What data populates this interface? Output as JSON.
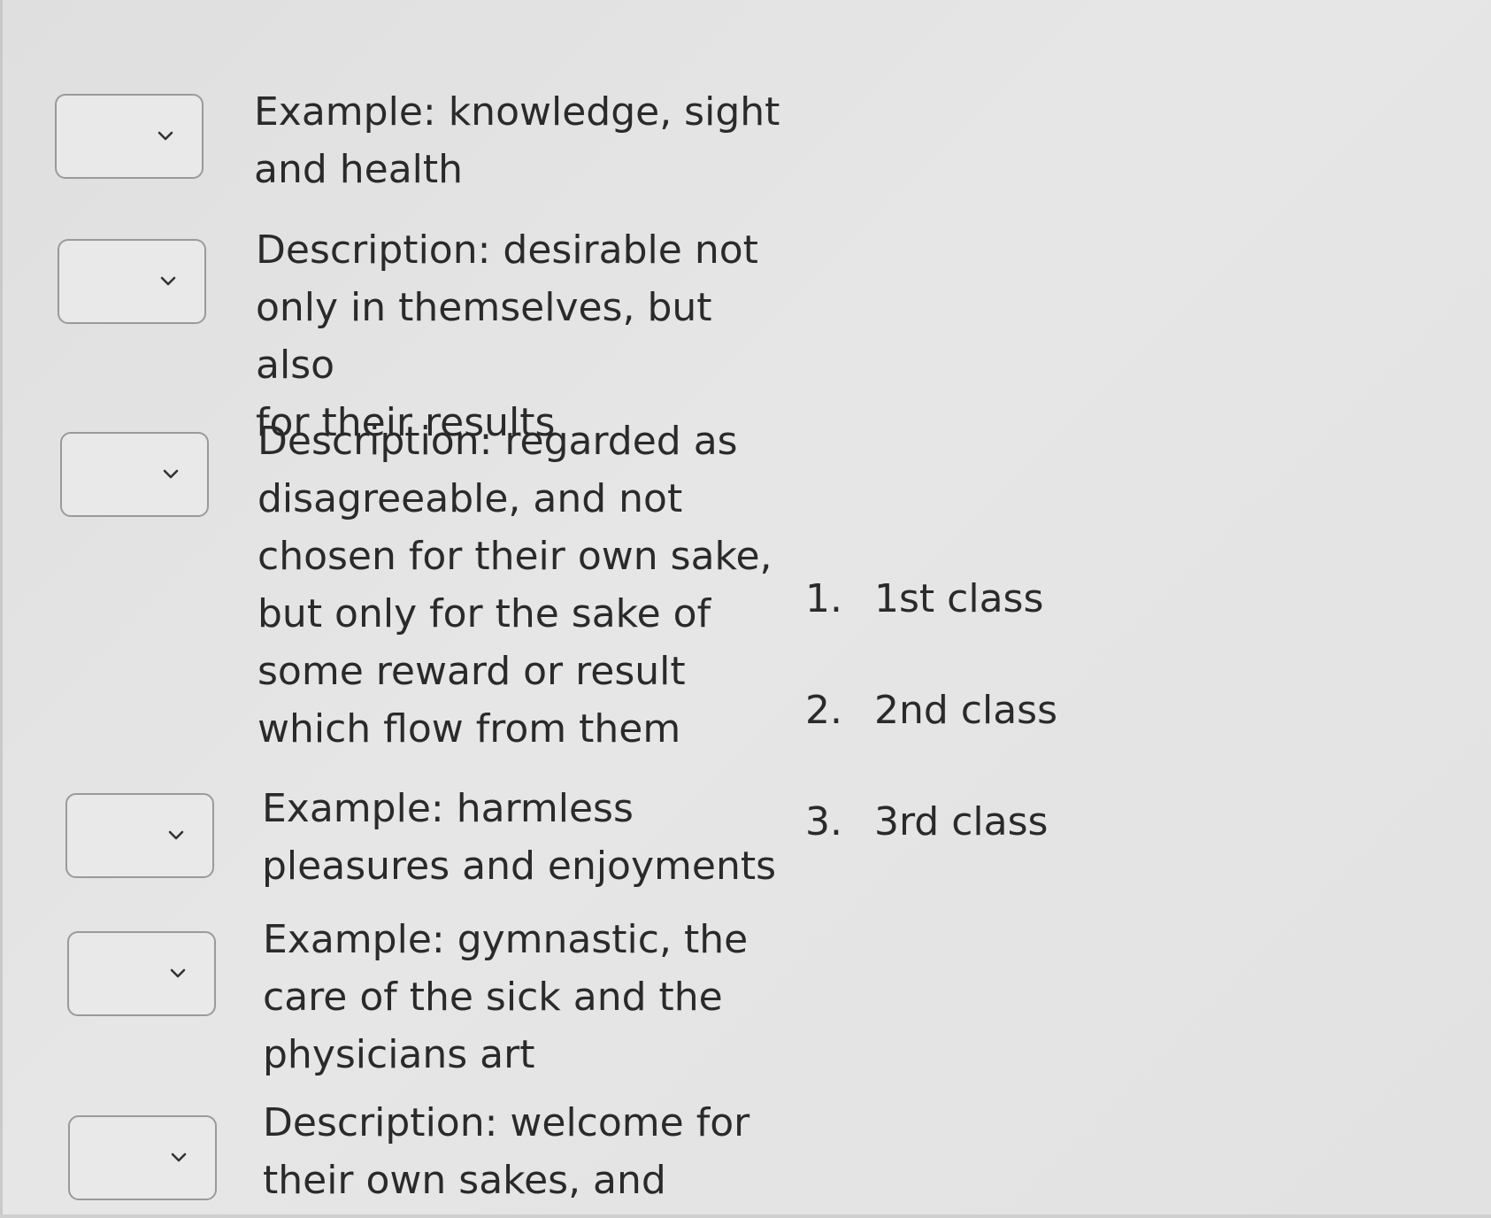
{
  "matching": {
    "items": [
      {
        "select_value": "",
        "text": "Example: knowledge, sight\nand health"
      },
      {
        "select_value": "",
        "text": "Description: desirable not\nonly in themselves, but also\nfor their results"
      },
      {
        "select_value": "",
        "text": "Description: regarded as\ndisagreeable, and not\nchosen for their own sake,\nbut only for the sake of\nsome reward or result\nwhich flow from them"
      },
      {
        "select_value": "",
        "text": "Example: harmless\npleasures and enjoyments"
      },
      {
        "select_value": "",
        "text": "Example: gymnastic, the\ncare of the sick and the\nphysicians art"
      },
      {
        "select_value": "",
        "text": "Description: welcome for\ntheir own sakes, and"
      }
    ],
    "options": [
      {
        "num": "1.",
        "label": "1st class"
      },
      {
        "num": "2.",
        "label": "2nd class"
      },
      {
        "num": "3.",
        "label": "3rd class"
      }
    ]
  },
  "icons": {
    "dropdown_icon": "chevron-down-icon"
  }
}
